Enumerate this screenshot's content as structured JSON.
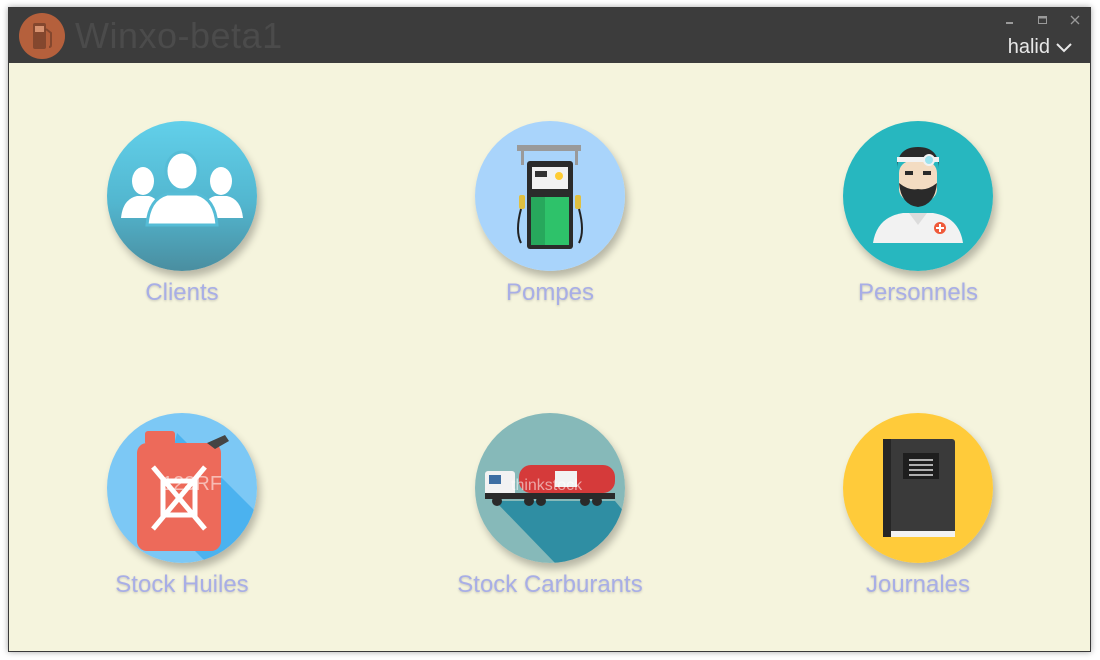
{
  "window": {
    "title": "Winxo-beta1",
    "user": "halid",
    "controls": [
      "minimize-icon",
      "maximize-icon",
      "close-icon"
    ]
  },
  "tiles": [
    {
      "label": "Clients",
      "icon": "clients-group-icon"
    },
    {
      "label": "Pompes",
      "icon": "fuel-pump-icon"
    },
    {
      "label": "Personnels",
      "icon": "staff-person-icon"
    },
    {
      "label": "Stock Huiles",
      "icon": "oil-jerrycan-icon"
    },
    {
      "label": "Stock Carburants",
      "icon": "fuel-tanker-truck-icon"
    },
    {
      "label": "Journales",
      "icon": "journal-book-icon"
    }
  ],
  "watermarks": [
    "123RF",
    "thinkstock"
  ],
  "colors": {
    "titlebar": "#3c3c3c",
    "background": "#f5f4dd",
    "label": "#a8aee6",
    "logo": "#b5603c"
  }
}
